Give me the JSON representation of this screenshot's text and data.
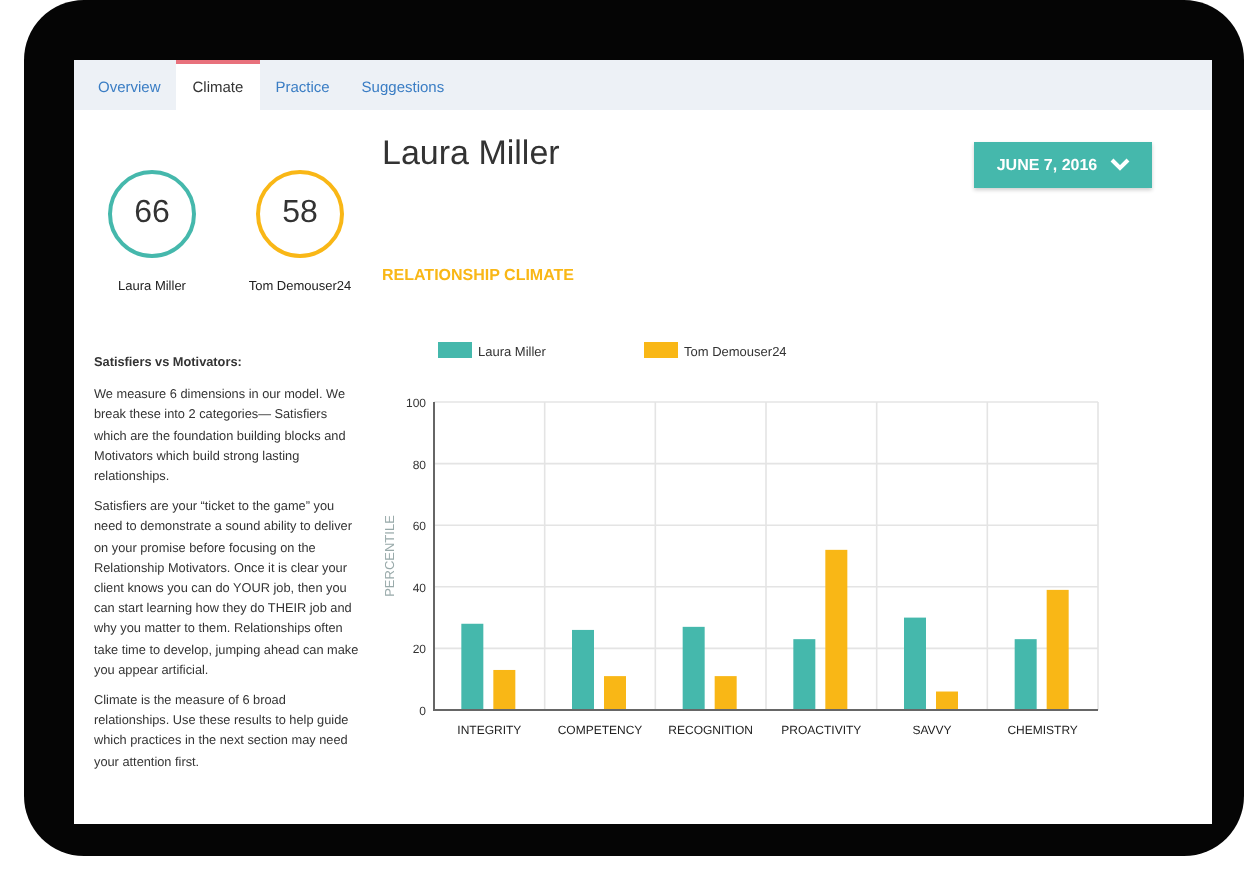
{
  "tabs": [
    {
      "label": "Overview",
      "selected": false
    },
    {
      "label": "Climate",
      "selected": true
    },
    {
      "label": "Practice",
      "selected": false
    },
    {
      "label": "Suggestions",
      "selected": false
    }
  ],
  "scores": [
    {
      "value": "66",
      "name": "Laura Miller",
      "color": "#45b8ac"
    },
    {
      "value": "58",
      "name": "Tom Demouser24",
      "color": "#f9b716"
    }
  ],
  "info": {
    "heading": "Satisfiers vs Motivators:",
    "paragraphs": [
      "We measure 6 dimensions in our model. We break these into 2 categories— Satisfiers which are the foundation building blocks and Motivators which build strong lasting relationships.",
      "Satisfiers are your “ticket to the game” you need to demonstrate a sound ability to deliver on your promise before focusing on the Relationship Motivators. Once it is clear your client knows you can do YOUR job, then you can start learning how they do THEIR job and why you matter to them. Relationships often take time to develop, jumping ahead can make you appear artificial.",
      "Climate is the measure of 6 broad relationships. Use these results to help guide which practices in the next section may need your attention first."
    ]
  },
  "title": "Laura Miller",
  "date_button": "JUNE 7, 2016",
  "section_title": "RELATIONSHIP CLIMATE",
  "chart_data": {
    "type": "bar",
    "ylabel": "PERCENTILE",
    "categories": [
      "INTEGRITY",
      "COMPETENCY",
      "RECOGNITION",
      "PROACTIVITY",
      "SAVVY",
      "CHEMISTRY"
    ],
    "series": [
      {
        "name": "Laura Miller",
        "color": "#45b8ac",
        "values": [
          28,
          26,
          27,
          23,
          30,
          23
        ]
      },
      {
        "name": "Tom Demouser24",
        "color": "#f9b716",
        "values": [
          13,
          11,
          11,
          52,
          6,
          39
        ]
      }
    ],
    "grid": true,
    "legend": "top",
    "ylim": [
      0,
      100
    ],
    "yticks": [
      0,
      20,
      40,
      60,
      80,
      100
    ]
  }
}
